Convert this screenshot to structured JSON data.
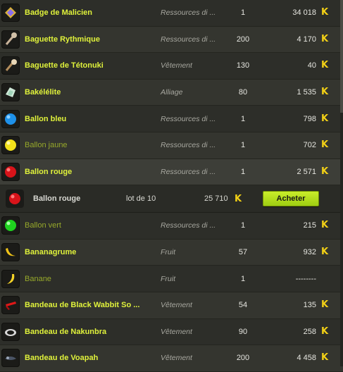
{
  "colors": {
    "accent_name": "#e0f23b",
    "dim_name": "#97a92a",
    "kamas": "#f3d116",
    "button": "#b5de1d"
  },
  "currency_icon": "kamas-icon",
  "currency_glyph": "K",
  "items": [
    {
      "name": "Badge de Malicien",
      "category": "Ressources di ...",
      "qty": "1",
      "price": "34 018",
      "icon": "badge-icon",
      "dim": false
    },
    {
      "name": "Baguette Rythmique",
      "category": "Ressources di ...",
      "qty": "200",
      "price": "4 170",
      "icon": "wand-icon",
      "dim": false
    },
    {
      "name": "Baguette de Tétonuki",
      "category": "Vêtement",
      "qty": "130",
      "price": "40",
      "icon": "wand-icon",
      "dim": false
    },
    {
      "name": "Bakélélite",
      "category": "Alliage",
      "qty": "80",
      "price": "1 535",
      "icon": "crystal-icon",
      "dim": false
    },
    {
      "name": "Ballon bleu",
      "category": "Ressources di ...",
      "qty": "1",
      "price": "798",
      "icon": "blue-balloon-icon",
      "dim": false
    },
    {
      "name": "Ballon jaune",
      "category": "Ressources di ...",
      "qty": "1",
      "price": "702",
      "icon": "yellow-balloon-icon",
      "dim": true
    },
    {
      "name": "Ballon rouge",
      "category": "Ressources di ...",
      "qty": "1",
      "price": "2 571",
      "icon": "red-balloon-icon",
      "dim": false
    }
  ],
  "buy": {
    "name": "Ballon rouge",
    "lot": "lot de 10",
    "price": "25 710",
    "button": "Acheter",
    "icon": "red-balloon-icon"
  },
  "items2": [
    {
      "name": "Ballon vert",
      "category": "Ressources di ...",
      "qty": "1",
      "price": "215",
      "icon": "green-balloon-icon",
      "dim": true
    },
    {
      "name": "Bananagrume",
      "category": "Fruit",
      "qty": "57",
      "price": "932",
      "icon": "banana-icon",
      "dim": false
    },
    {
      "name": "Banane",
      "category": "Fruit",
      "qty": "1",
      "price": "--------",
      "icon": "banana-icon",
      "dim": true,
      "no_k": true
    },
    {
      "name": "Bandeau de Black Wabbit So ...",
      "category": "Vêtement",
      "qty": "54",
      "price": "135",
      "icon": "headband-icon",
      "dim": false
    },
    {
      "name": "Bandeau de Nakunbra",
      "category": "Vêtement",
      "qty": "90",
      "price": "258",
      "icon": "headband-icon",
      "dim": false
    },
    {
      "name": "Bandeau de Voapah",
      "category": "Vêtement",
      "qty": "200",
      "price": "4 458",
      "icon": "headband-icon",
      "dim": false
    }
  ]
}
